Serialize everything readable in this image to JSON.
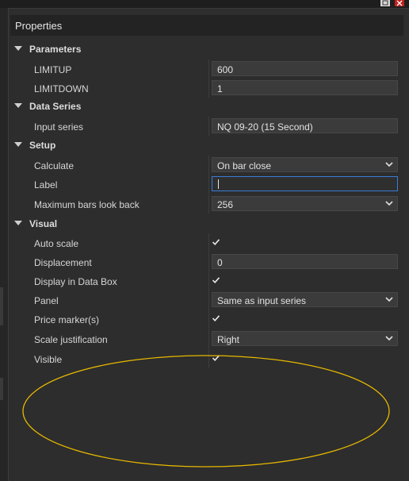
{
  "panel": {
    "title": "Properties"
  },
  "parameters": {
    "header": "Parameters",
    "limitup": {
      "label": "LIMITUP",
      "value": "600"
    },
    "limitdown": {
      "label": "LIMITDOWN",
      "value": "1"
    }
  },
  "data_series": {
    "header": "Data Series",
    "input_series": {
      "label": "Input series",
      "value": "NQ 09-20 (15 Second)"
    }
  },
  "setup": {
    "header": "Setup",
    "calculate": {
      "label": "Calculate",
      "value": "On bar close"
    },
    "label": {
      "label": "Label",
      "value": ""
    },
    "max_bars": {
      "label": "Maximum bars look back",
      "value": "256"
    }
  },
  "visual": {
    "header": "Visual",
    "auto_scale": {
      "label": "Auto scale",
      "checked": true
    },
    "displacement": {
      "label": "Displacement",
      "value": "0"
    },
    "display_data_box": {
      "label": "Display in Data Box",
      "checked": true
    },
    "panel": {
      "label": "Panel",
      "value": "Same as input series"
    },
    "price_marker": {
      "label": "Price marker(s)",
      "checked": true
    },
    "scale_justification": {
      "label": "Scale justification",
      "value": "Right"
    },
    "visible": {
      "label": "Visible",
      "checked": true
    }
  },
  "annotation": {
    "shape": "ellipse",
    "color": "#e6b800"
  },
  "colors": {
    "accent_focus": "#3a7bd5",
    "window_close": "#c0211d"
  }
}
